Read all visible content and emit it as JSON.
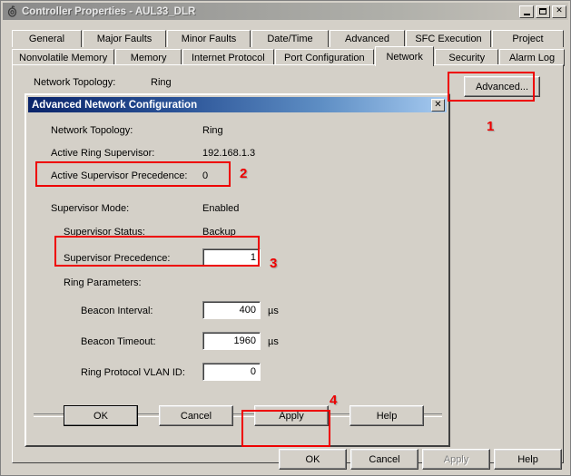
{
  "window": {
    "title": "Controller Properties - AUL33_DLR",
    "icon": "controller-icon",
    "minimize_label": "_",
    "maximize_label": "□",
    "close_label": "✕"
  },
  "tabs": {
    "row1": [
      {
        "label": "General",
        "selected": false
      },
      {
        "label": "Major Faults",
        "selected": false
      },
      {
        "label": "Minor Faults",
        "selected": false
      },
      {
        "label": "Date/Time",
        "selected": false
      },
      {
        "label": "Advanced",
        "selected": false
      },
      {
        "label": "SFC Execution",
        "selected": false
      },
      {
        "label": "Project",
        "selected": false
      }
    ],
    "row2": [
      {
        "label": "Nonvolatile Memory",
        "selected": false
      },
      {
        "label": "Memory",
        "selected": false
      },
      {
        "label": "Internet Protocol",
        "selected": false
      },
      {
        "label": "Port Configuration",
        "selected": false
      },
      {
        "label": "Network",
        "selected": true
      },
      {
        "label": "Security",
        "selected": false
      },
      {
        "label": "Alarm Log",
        "selected": false
      }
    ]
  },
  "network_tab": {
    "topology_label": "Network Topology:",
    "topology_value": "Ring",
    "advanced_button": "Advanced..."
  },
  "dialog": {
    "title": "Advanced Network Configuration",
    "close_label": "✕",
    "fields": {
      "topology_label": "Network Topology:",
      "topology_value": "Ring",
      "active_ring_supervisor_label": "Active Ring Supervisor:",
      "active_ring_supervisor_value": "192.168.1.3",
      "active_supervisor_precedence_label": "Active Supervisor Precedence:",
      "active_supervisor_precedence_value": "0",
      "supervisor_mode_label": "Supervisor Mode:",
      "supervisor_mode_value": "Enabled",
      "supervisor_status_label": "Supervisor Status:",
      "supervisor_status_value": "Backup",
      "supervisor_precedence_label": "Supervisor Precedence:",
      "supervisor_precedence_value": "1",
      "ring_parameters_label": "Ring Parameters:",
      "beacon_interval_label": "Beacon Interval:",
      "beacon_interval_value": "400",
      "beacon_interval_unit": "µs",
      "beacon_timeout_label": "Beacon Timeout:",
      "beacon_timeout_value": "1960",
      "beacon_timeout_unit": "µs",
      "vlan_id_label": "Ring Protocol VLAN ID:",
      "vlan_id_value": "0"
    },
    "buttons": {
      "ok": "OK",
      "cancel": "Cancel",
      "apply": "Apply",
      "help": "Help"
    }
  },
  "main_buttons": {
    "ok": "OK",
    "cancel": "Cancel",
    "apply": "Apply",
    "help": "Help"
  },
  "annotations": {
    "markers": [
      "1",
      "2",
      "3",
      "4"
    ],
    "color": "#ee0000"
  }
}
